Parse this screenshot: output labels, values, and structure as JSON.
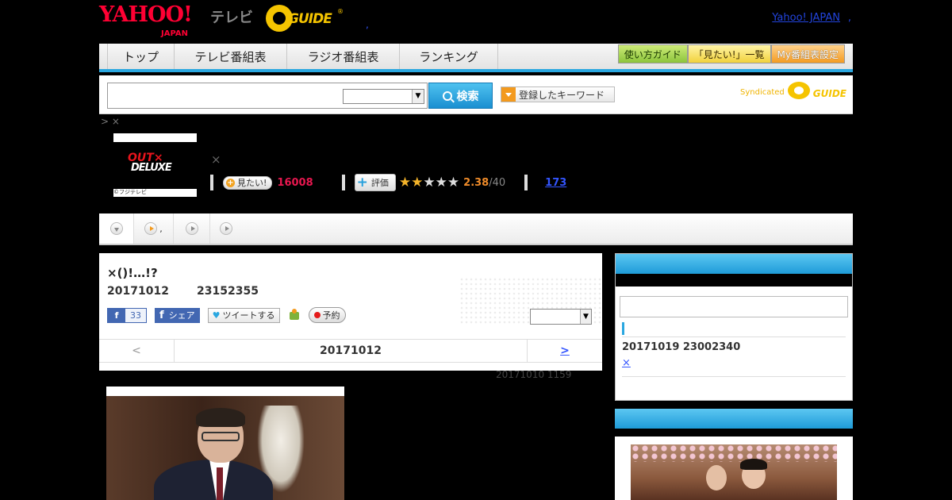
{
  "header": {
    "yahoo_logo": "YAHOO!",
    "yahoo_logo_sub": "JAPAN",
    "tv_label": "テレビ",
    "gguide_logo": "GUIDE",
    "gguide_mark": "®",
    "dot": ",",
    "yahoo_japan_link": "Yahoo! JAPAN",
    "link_sep": ","
  },
  "nav": {
    "tabs": [
      {
        "label": "トップ"
      },
      {
        "label": "テレビ番組表"
      },
      {
        "label": "ラジオ番組表"
      },
      {
        "label": "ランキング"
      }
    ],
    "buttons": {
      "guide": "使い方ガイド",
      "want_list": "「見たい!」一覧",
      "my_schedule": "My番組表設定"
    }
  },
  "search": {
    "input_value": "",
    "select_value": "",
    "button_label": "検索",
    "keyword_label": "登録したキーワード",
    "syndicated_label": "Syndicated",
    "syndicated_logo": "GUIDE"
  },
  "program": {
    "breadcrumb": "> ×",
    "thumb_logo_top": "OUT×",
    "thumb_logo_bottom": "DELUXE",
    "thumb_copyright": "©フジテレビ",
    "close_symbol": "×",
    "want_label": "見たい!",
    "want_count": "16008",
    "rate_label": "評価",
    "stars_filled": 2,
    "stars_total": 5,
    "rating": "2.38",
    "rating_max": "/40",
    "review_count": "173"
  },
  "tabstrip": {
    "tab2_suffix": ","
  },
  "episode": {
    "title": "×()!…!?",
    "date": "20171012",
    "time": "23152355",
    "fb_like_count": "33",
    "fb_share_label": "シェア",
    "tweet_label": "ツイートする",
    "reserve_label": "予約",
    "select_value": "",
    "nav_prev": "<",
    "nav_current": "20171012",
    "nav_next": ">",
    "updated": "20171010  1159"
  },
  "sidebar": {
    "search_value": "",
    "schedule_text": "20171019  23002340",
    "close_link": "×"
  },
  "colors": {
    "accent_blue": "#2aa7e0",
    "want_pink": "#e8174f",
    "rating_orange": "#f08c2a",
    "link_blue": "#3355ff"
  },
  "icons": [
    "search-icon",
    "dropdown-arrow-icon",
    "plus-icon",
    "star-icon",
    "play-icon",
    "facebook-icon",
    "twitter-icon",
    "mixi-icon",
    "record-dot-icon"
  ]
}
